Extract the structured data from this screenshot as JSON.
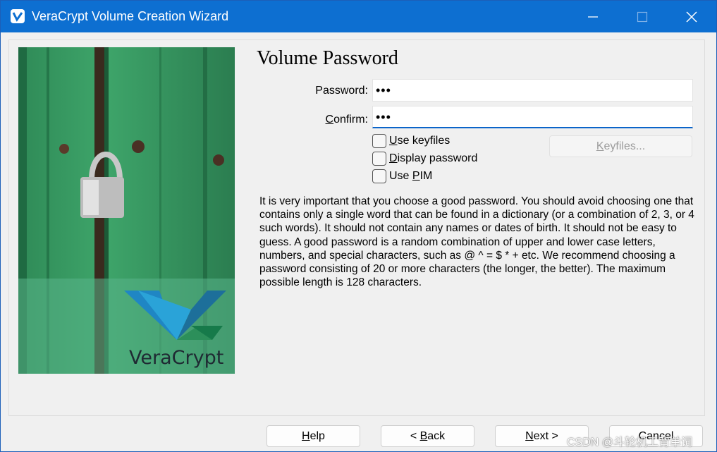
{
  "window": {
    "title": "VeraCrypt Volume Creation Wizard",
    "accent_color": "#0d6fd1",
    "controls": [
      "minimize-icon",
      "maximize-icon",
      "close-icon"
    ]
  },
  "sidebar": {
    "logo_text_a": "Vera",
    "logo_text_b": "Crypt"
  },
  "main": {
    "heading": "Volume Password",
    "password": {
      "label": "Password:",
      "value": "•••"
    },
    "confirm": {
      "label_first": "C",
      "label_rest": "onfirm:",
      "value": "•••"
    },
    "options": [
      {
        "accel": "U",
        "rest": "se keyfiles",
        "checked": false
      },
      {
        "accel": "D",
        "rest": "isplay password",
        "checked": false
      },
      {
        "prefix": "Use ",
        "accel": "P",
        "rest": "IM",
        "checked": false
      }
    ],
    "keyfiles_button": {
      "accel": "K",
      "rest": "eyfiles...",
      "enabled": false
    },
    "info_text": "It is very important that you choose a good password. You should avoid choosing one that contains only a single word that can be found in a dictionary (or a combination of 2, 3, or 4 such words). It should not contain any names or dates of birth. It should not be easy to guess. A good password is a random combination of upper and lower case letters, numbers, and special characters, such as @ ^ = $ * + etc. We recommend choosing a password consisting of 20 or more characters (the longer, the better). The maximum possible length is 128 characters."
  },
  "footer": {
    "help": {
      "accel": "H",
      "rest": "elp"
    },
    "back": {
      "prefix": "< ",
      "accel": "B",
      "rest": "ack"
    },
    "next": {
      "accel": "N",
      "rest": "ext >"
    },
    "cancel": {
      "label": "Cancel"
    }
  },
  "watermark": "CSDN @斗轮机工背单词"
}
